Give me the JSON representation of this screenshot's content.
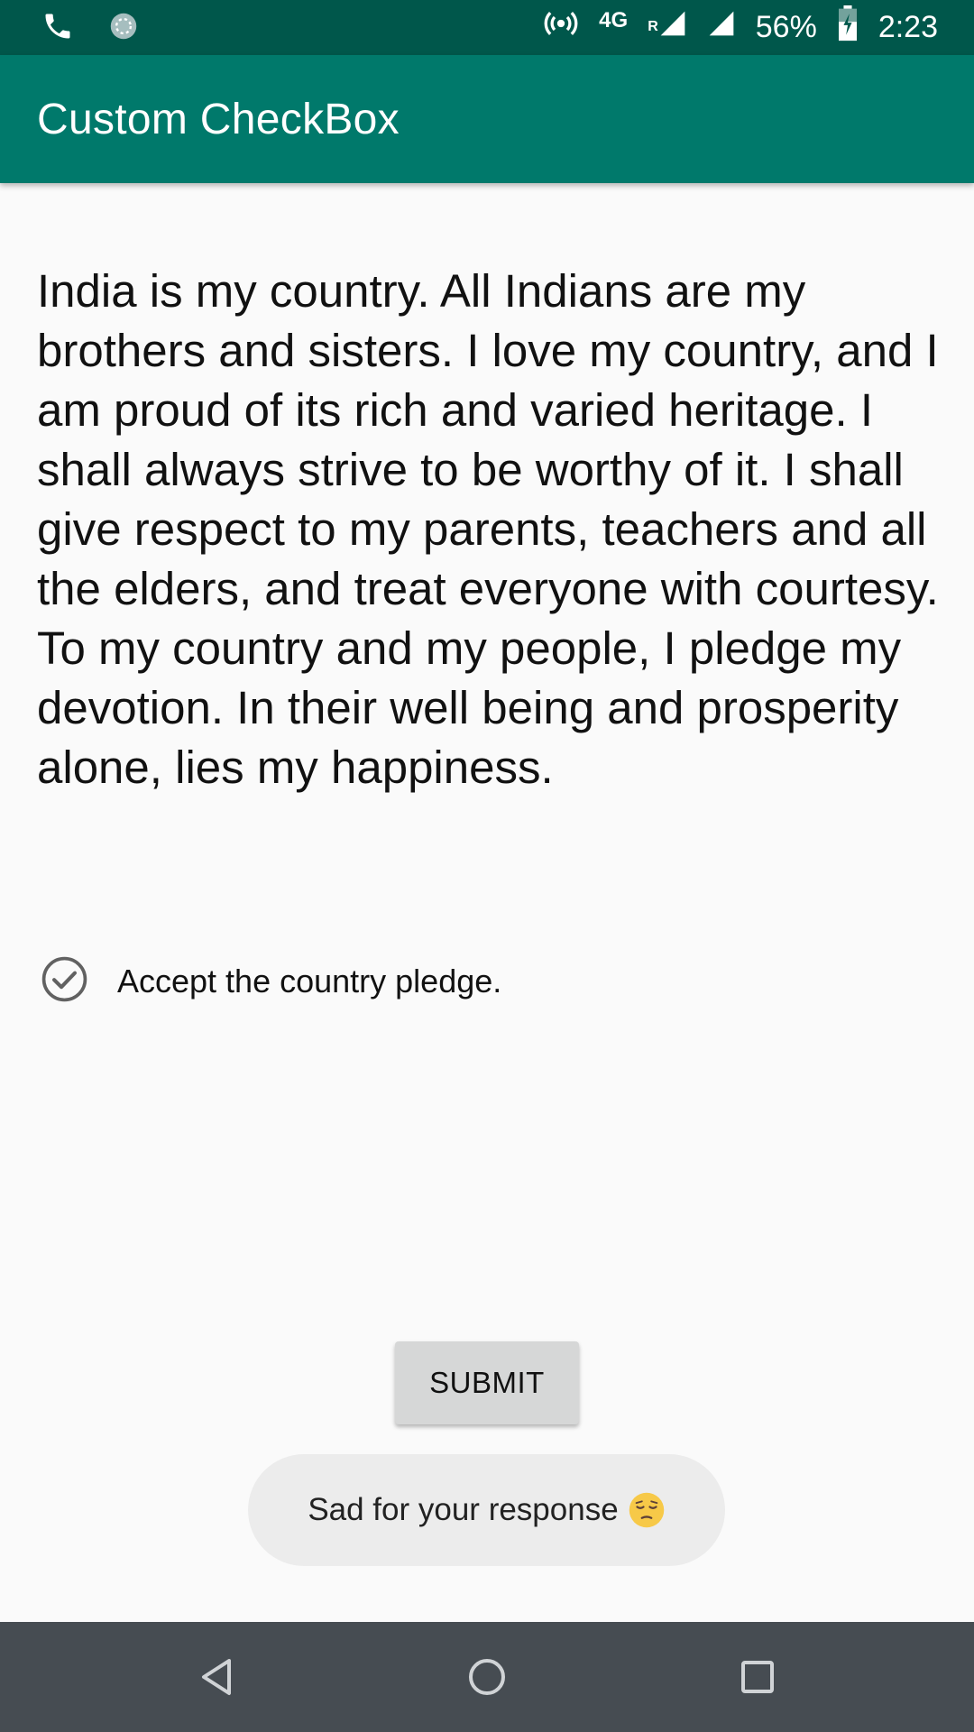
{
  "status_bar": {
    "network_type": "4G",
    "roaming": "R",
    "battery": "56%",
    "time": "2:23",
    "left_icons": [
      "phone-icon",
      "loading-icon"
    ],
    "right_icons": [
      "hotspot-icon",
      "signal-icon",
      "signal-icon",
      "battery-charging-icon"
    ]
  },
  "app_bar": {
    "title": "Custom CheckBox",
    "color": "#00796b",
    "status_color": "#00574b"
  },
  "content": {
    "pledge_text": "India is my country. All Indians are my brothers and sisters. I love my country, and I am proud of its rich and varied heritage. I shall always strive to be worthy of it. I shall give respect to my parents, teachers and all the elders, and treat everyone with courtesy. To my country and my people, I pledge my devotion. In their well being and prosperity alone, lies my happiness.",
    "checkbox": {
      "label": "Accept the country pledge.",
      "icon": "check-circle-icon",
      "checked": false
    },
    "submit_label": "SUBMIT"
  },
  "toast": {
    "message": "Sad for your response",
    "emoji": "pensive-face-icon"
  },
  "nav_bar": {
    "buttons": [
      "back-icon",
      "home-icon",
      "recents-icon"
    ]
  }
}
